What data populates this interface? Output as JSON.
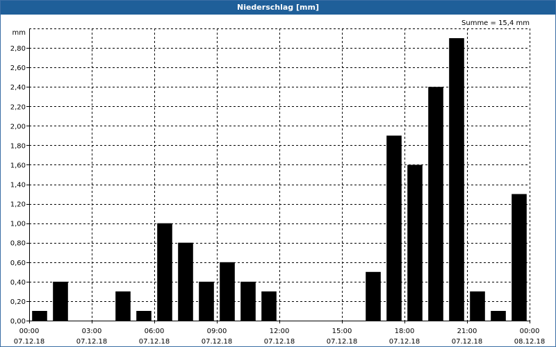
{
  "window": {
    "title": "Niederschlag [mm]"
  },
  "chart": {
    "sum_label": "Summe = 15,4 mm"
  },
  "chart_data": {
    "type": "bar",
    "title": "Niederschlag [mm]",
    "ylabel": "mm",
    "xlabel": "",
    "ylim": [
      0,
      3.0
    ],
    "grid": true,
    "bar_color": "#000000",
    "y_ticks": [
      "0,00",
      "0,20",
      "0,40",
      "0,60",
      "0,80",
      "1,00",
      "1,20",
      "1,40",
      "1,60",
      "1,80",
      "2,00",
      "2,20",
      "2,40",
      "2,60",
      "2,80"
    ],
    "x_ticks": [
      {
        "time": "00:00",
        "date": "07.12.18"
      },
      {
        "time": "03:00",
        "date": "07.12.18"
      },
      {
        "time": "06:00",
        "date": "07.12.18"
      },
      {
        "time": "09:00",
        "date": "07.12.18"
      },
      {
        "time": "12:00",
        "date": "07.12.18"
      },
      {
        "time": "15:00",
        "date": "07.12.18"
      },
      {
        "time": "18:00",
        "date": "07.12.18"
      },
      {
        "time": "21:00",
        "date": "07.12.18"
      },
      {
        "time": "00:00",
        "date": "08.12.18"
      }
    ],
    "categories": [
      "00:00",
      "01:00",
      "02:00",
      "03:00",
      "04:00",
      "05:00",
      "06:00",
      "07:00",
      "08:00",
      "09:00",
      "10:00",
      "11:00",
      "12:00",
      "13:00",
      "14:00",
      "15:00",
      "16:00",
      "17:00",
      "18:00",
      "19:00",
      "20:00",
      "21:00",
      "22:00",
      "23:00"
    ],
    "values": [
      0.1,
      0.4,
      0.0,
      0.0,
      0.3,
      0.1,
      1.0,
      0.8,
      0.4,
      0.6,
      0.4,
      0.3,
      0.0,
      0.0,
      0.0,
      0.0,
      0.5,
      1.9,
      1.6,
      2.4,
      2.9,
      0.3,
      0.1,
      1.3
    ]
  }
}
